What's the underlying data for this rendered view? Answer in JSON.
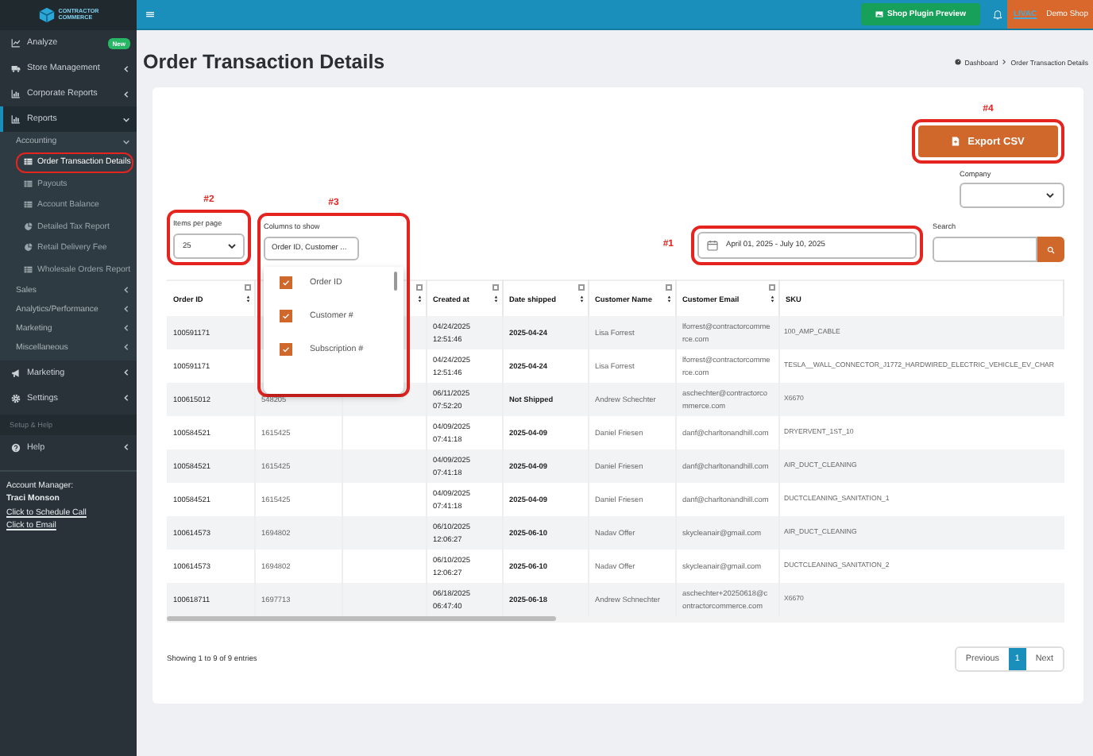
{
  "sidebar": {
    "logo": [
      "CONTRACTOR",
      "COMMERCE"
    ],
    "nav": [
      {
        "label": "Analyze",
        "badge": "New",
        "selected": false
      },
      {
        "label": "Store Management",
        "expanded": false,
        "selected": false
      },
      {
        "label": "Corporate Reports",
        "expanded": false,
        "selected": false
      },
      {
        "label": "Reports",
        "expanded": true,
        "selected": true,
        "children": [
          {
            "label": "Accounting",
            "expanded": true,
            "children": [
              {
                "label": "Order Transaction Details",
                "selected": true,
                "circled": true
              },
              {
                "label": "Payouts",
                "selected": false,
                "circled": false
              },
              {
                "label": "Account Balance",
                "selected": false,
                "circled": false
              },
              {
                "label": "Detailed Tax Report",
                "selected": false,
                "circled": false
              },
              {
                "label": "Retail Delivery Fee",
                "selected": false,
                "circled": false
              },
              {
                "label": "Wholesale Orders Report",
                "selected": false,
                "circled": false
              }
            ]
          },
          {
            "label": "Sales",
            "expanded": false
          },
          {
            "label": "Analytics/Performance",
            "expanded": false
          },
          {
            "label": "Marketing",
            "expanded": false
          },
          {
            "label": "Miscellaneous",
            "expanded": false
          }
        ]
      },
      {
        "label": "Marketing",
        "expanded": false,
        "selected": false
      },
      {
        "label": "Settings",
        "expanded": false,
        "selected": false
      }
    ],
    "section": "Setup & Help",
    "bottom_nav": [
      {
        "label": "Help",
        "expanded": false,
        "selected": false
      }
    ],
    "account": {
      "heading": "Account Manager:",
      "name": "Traci Monson",
      "links": [
        "Click to Schedule Call",
        "Click to Email"
      ]
    }
  },
  "topbar": {
    "preview_button": "Shop Plugin Preview",
    "shop_logo": "LIVAC",
    "shop_name": "Demo Shop"
  },
  "page": {
    "title": "Order Transaction Details",
    "breadcrumb": [
      "Dashboard",
      "Order Transaction Details"
    ]
  },
  "export": {
    "label": "Export CSV",
    "annotation": "#4"
  },
  "company": {
    "label": "Company"
  },
  "items_per_page": {
    "label": "Items per page",
    "value": "25",
    "annotation": "#2"
  },
  "columns_to_show": {
    "label": "Columns to show",
    "value": "Order ID, Customer ...",
    "annotation": "#3",
    "options": [
      {
        "label": "Order ID",
        "checked": true
      },
      {
        "label": "Customer #",
        "checked": true
      },
      {
        "label": "Subscription #",
        "checked": true
      }
    ]
  },
  "date_range": {
    "value": "April 01, 2025 - July 10, 2025",
    "annotation": "#1"
  },
  "search": {
    "label": "Search"
  },
  "table": {
    "columns": [
      {
        "label": "Order ID",
        "sortable": true
      },
      {},
      {
        "sortable": true
      },
      {
        "label": "Created at",
        "sortable": true
      },
      {
        "label": "Date shipped",
        "sortable": true
      },
      {
        "label": "Customer Name",
        "sortable": true
      },
      {
        "label": "Customer Email",
        "sortable": true
      },
      {
        "label": "SKU",
        "sortable": false
      }
    ],
    "rows": [
      [
        "100591171",
        null,
        null,
        "04/24/2025 12:51:46",
        "2025-04-24",
        "Lisa Forrest",
        "lforrest@contractorcommerce.com",
        "100_AMP_CABLE"
      ],
      [
        "100591171",
        null,
        null,
        "04/24/2025 12:51:46",
        "2025-04-24",
        "Lisa Forrest",
        "lforrest@contractorcommerce.com",
        "TESLA__WALL_CONNECTOR_J1772_HARDWIRED_ELECTRIC_VEHICLE_EV_CHAR"
      ],
      [
        "100615012",
        "548205",
        null,
        "06/11/2025 07:52:20",
        "Not Shipped",
        "Andrew Schechter",
        "aschechter@contractorcommerce.com",
        "X6670"
      ],
      [
        "100584521",
        "1615425",
        null,
        "04/09/2025 07:41:18",
        "2025-04-09",
        "Daniel Friesen",
        "danf@charltonandhill.com",
        "DRYERVENT_1ST_10"
      ],
      [
        "100584521",
        "1615425",
        null,
        "04/09/2025 07:41:18",
        "2025-04-09",
        "Daniel Friesen",
        "danf@charltonandhill.com",
        "AIR_DUCT_CLEANING"
      ],
      [
        "100584521",
        "1615425",
        null,
        "04/09/2025 07:41:18",
        "2025-04-09",
        "Daniel Friesen",
        "danf@charltonandhill.com",
        "DUCTCLEANING_SANITATION_1"
      ],
      [
        "100614573",
        "1694802",
        null,
        "06/10/2025 12:06:27",
        "2025-06-10",
        "Nadav Offer",
        "skycleanair@gmail.com",
        "AIR_DUCT_CLEANING"
      ],
      [
        "100614573",
        "1694802",
        null,
        "06/10/2025 12:06:27",
        "2025-06-10",
        "Nadav Offer",
        "skycleanair@gmail.com",
        "DUCTCLEANING_SANITATION_2"
      ],
      [
        "100618711",
        "1697713",
        null,
        "06/18/2025 06:47:40",
        "2025-06-18",
        "Andrew Schnechter",
        "aschechter+20250618@contractorcommerce.com",
        "X6670"
      ]
    ]
  },
  "footer": {
    "info": "Showing 1 to 9 of 9 entries",
    "previous": "Previous",
    "pages": [
      {
        "label": "1",
        "selected": true
      }
    ],
    "next": "Next"
  }
}
